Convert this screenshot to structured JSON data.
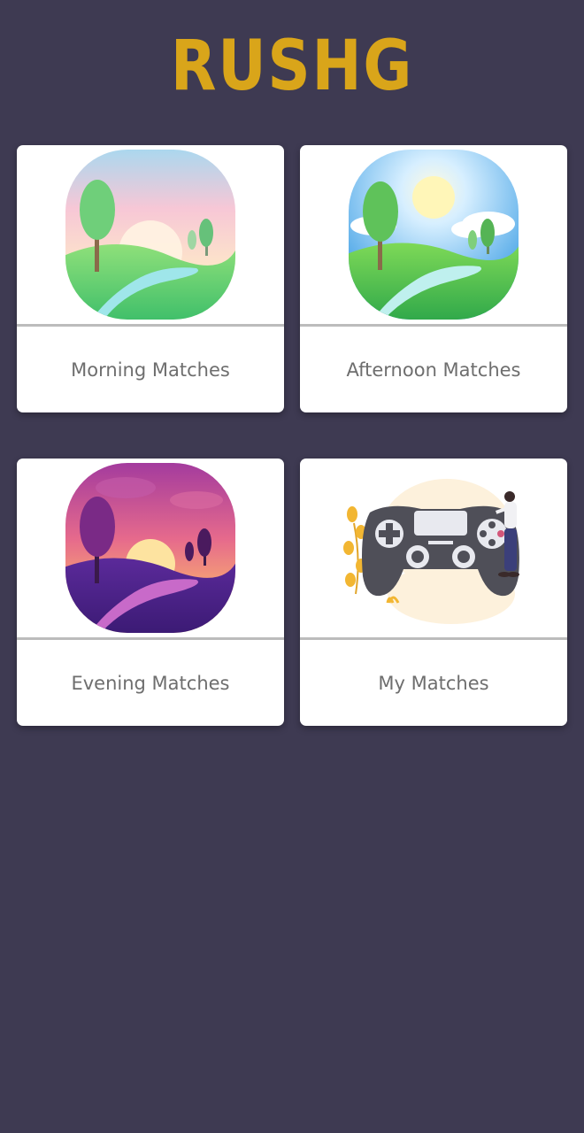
{
  "app": {
    "logo_text": "RUSHG",
    "brand_color": "#d9a51a",
    "background_color": "#3e3a52"
  },
  "cards": [
    {
      "label": "Morning Matches",
      "icon": "morning-landscape-icon"
    },
    {
      "label": "Afternoon Matches",
      "icon": "afternoon-landscape-icon"
    },
    {
      "label": "Evening Matches",
      "icon": "evening-landscape-icon"
    },
    {
      "label": "My Matches",
      "icon": "game-controller-icon"
    }
  ]
}
